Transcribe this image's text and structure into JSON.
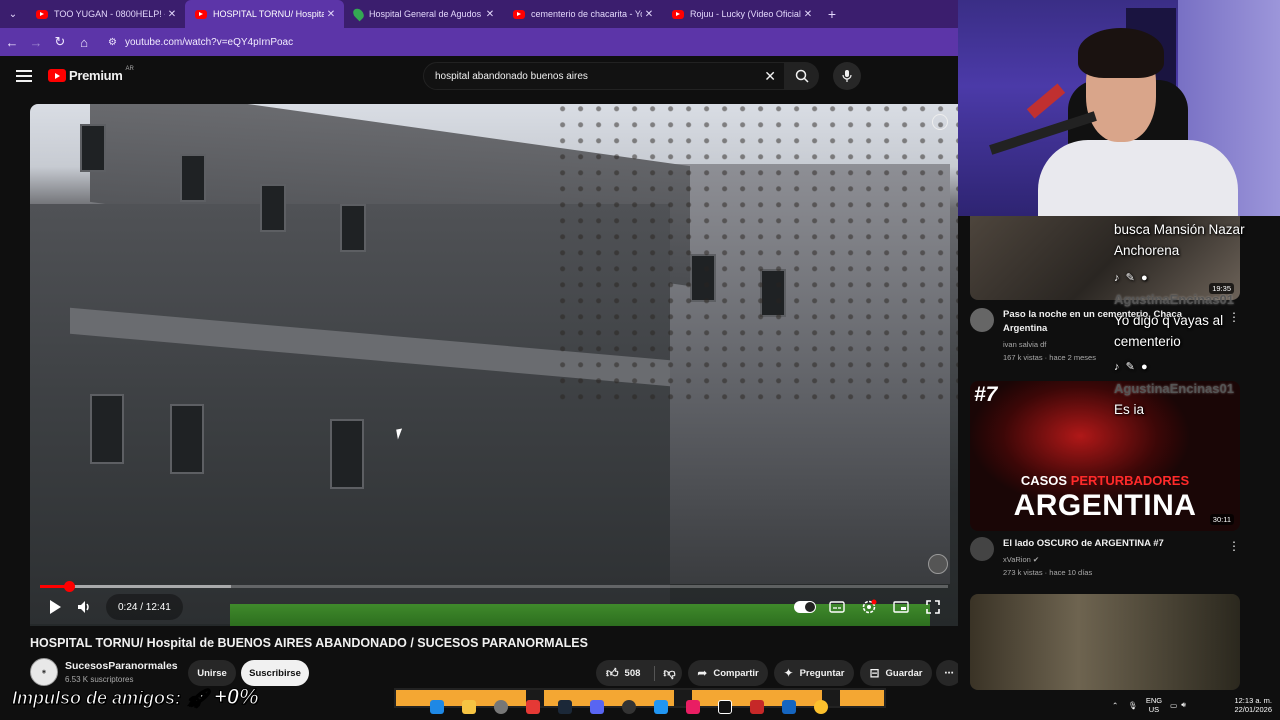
{
  "browser": {
    "tabs": [
      {
        "title": "TOO YUGAN - 0800HELP! - You",
        "favicon": "youtube-icon",
        "active": false
      },
      {
        "title": "HOSPITAL TORNU/ Hospital de",
        "favicon": "youtube-icon",
        "active": true
      },
      {
        "title": "Hospital General de Agudos Dr.",
        "favicon": "maps-icon",
        "active": false
      },
      {
        "title": "cementerio de chacarita - YouT",
        "favicon": "youtube-icon",
        "active": false
      },
      {
        "title": "Rojuu - Lucky (Video Oficial) - Y",
        "favicon": "youtube-icon",
        "active": false
      }
    ],
    "url": "youtube.com/watch?v=eQY4pIrnPoac",
    "theme_color": "#5c35a8"
  },
  "youtube": {
    "logo_text": "Premium",
    "country_code": "AR",
    "search_query": "hospital abandonado buenos aires"
  },
  "player": {
    "current_time": "0:24",
    "duration": "12:41",
    "time_label": "0:24 / 12:41",
    "played_fraction": 0.0315,
    "buffered_fraction": 0.21,
    "accent": "#ff0000"
  },
  "video": {
    "title": "HOSPITAL TORNU/ Hospital de BUENOS AIRES ABANDONADO / SUCESOS PARANORMALES",
    "channel": "SucesosParanormales",
    "subscribers": "6.53 K suscriptores",
    "join_label": "Unirse",
    "subscribe_label": "Suscribirse",
    "likes": "508",
    "share_label": "Compartir",
    "ask_label": "Preguntar",
    "save_label": "Guardar"
  },
  "sidebar": {
    "items": [
      {
        "title_line1": "Paso la noche en un cementerio, Chaca",
        "title_line2": "Argentina",
        "channel": "ivan salvia df",
        "meta": "167 k vistas · hace 2 meses",
        "duration": "19:35"
      },
      {
        "thumb_rank": "#7",
        "thumb_line1a": "CASOS ",
        "thumb_line1b": "PERTURBADORES",
        "thumb_line2": "ARGENTINA",
        "title": "El lado OSCURO de ARGENTINA #7",
        "channel": "xVaRion",
        "meta": "273 k vistas · hace 10 días",
        "duration": "30:11"
      }
    ]
  },
  "chat": {
    "messages": [
      {
        "text": "busca Mansión Nazar Anchorena"
      },
      {
        "user": "AgustinaEncinas01",
        "text": "Yo digo q vayas al cementerio"
      },
      {
        "user": "AgustinaEncinas01",
        "text": "Es ia"
      }
    ]
  },
  "overlay": {
    "impulso_label": "Impulso de amigos:",
    "impulso_value": "+0%"
  },
  "system": {
    "lang_line1": "ENG",
    "lang_line2": "US",
    "time": "12:13 a. m.",
    "date": "22/01/2026"
  }
}
